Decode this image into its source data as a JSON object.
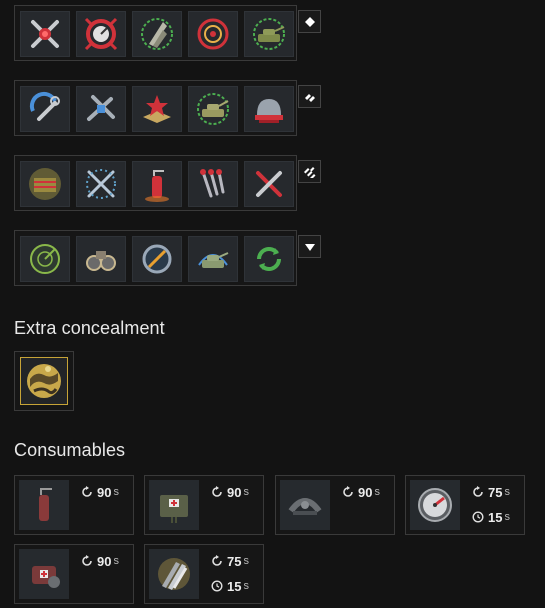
{
  "skill_rows": [
    {
      "tier_marker": "diamond-1",
      "skills": [
        "crosshair-repair-icon",
        "speedometer-icon",
        "shell-sheaf-icon",
        "target-aim-icon",
        "tank-glow-icon"
      ]
    },
    {
      "tier_marker": "diamond-2",
      "skills": [
        "wrench-swirl-icon",
        "crossed-guns-icon",
        "star-map-icon",
        "tank-green-icon",
        "helmet-icon"
      ]
    },
    {
      "tier_marker": "diamond-3",
      "skills": [
        "ammo-crate-icon",
        "crossed-swords-icon",
        "fire-extinguisher-icon",
        "parachute-shells-icon",
        "crossed-wrench-icon"
      ]
    },
    {
      "tier_marker": "triangle-down",
      "skills": [
        "radar-icon",
        "binoculars-icon",
        "no-sign-icon",
        "tank-blue-icon",
        "recycle-icon"
      ]
    }
  ],
  "extra_concealment": {
    "title": "Extra concealment",
    "item": "camouflage-icon"
  },
  "consumables": {
    "title": "Consumables",
    "items": [
      {
        "icon": "fire-extinguisher-icon",
        "cooldown": "90",
        "cooldown_unit": "s"
      },
      {
        "icon": "medkit-icon",
        "cooldown": "90",
        "cooldown_unit": "s"
      },
      {
        "icon": "track-repair-icon",
        "cooldown": "90",
        "cooldown_unit": "s"
      },
      {
        "icon": "speed-gauge-icon",
        "cooldown": "75",
        "cooldown_unit": "s",
        "duration": "15",
        "duration_unit": "s"
      },
      {
        "icon": "repair-kit-icon",
        "cooldown": "90",
        "cooldown_unit": "s"
      },
      {
        "icon": "shell-boost-icon",
        "cooldown": "75",
        "cooldown_unit": "s",
        "duration": "15",
        "duration_unit": "s"
      }
    ]
  },
  "colors": {
    "background": "#131313",
    "accent_gold": "#c7a437",
    "slot": "#26292d"
  }
}
